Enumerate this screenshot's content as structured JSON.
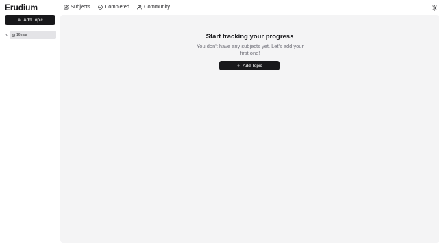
{
  "app": {
    "title": "Erudium"
  },
  "nav": {
    "items": [
      {
        "label": "Subjects",
        "icon": "edit-square-icon"
      },
      {
        "label": "Completed",
        "icon": "check-circle-icon"
      },
      {
        "label": "Community",
        "icon": "users-icon"
      }
    ]
  },
  "header": {
    "theme_icon": "sun-icon"
  },
  "sidebar": {
    "add_label": "Add Topic",
    "tree": [
      {
        "label": "16 mar",
        "icon": "calendar-icon"
      }
    ]
  },
  "main": {
    "title": "Start tracking your progress",
    "subtitle": "You don't have any subjects yet. Let's add your first one!",
    "add_label": "Add Topic"
  }
}
